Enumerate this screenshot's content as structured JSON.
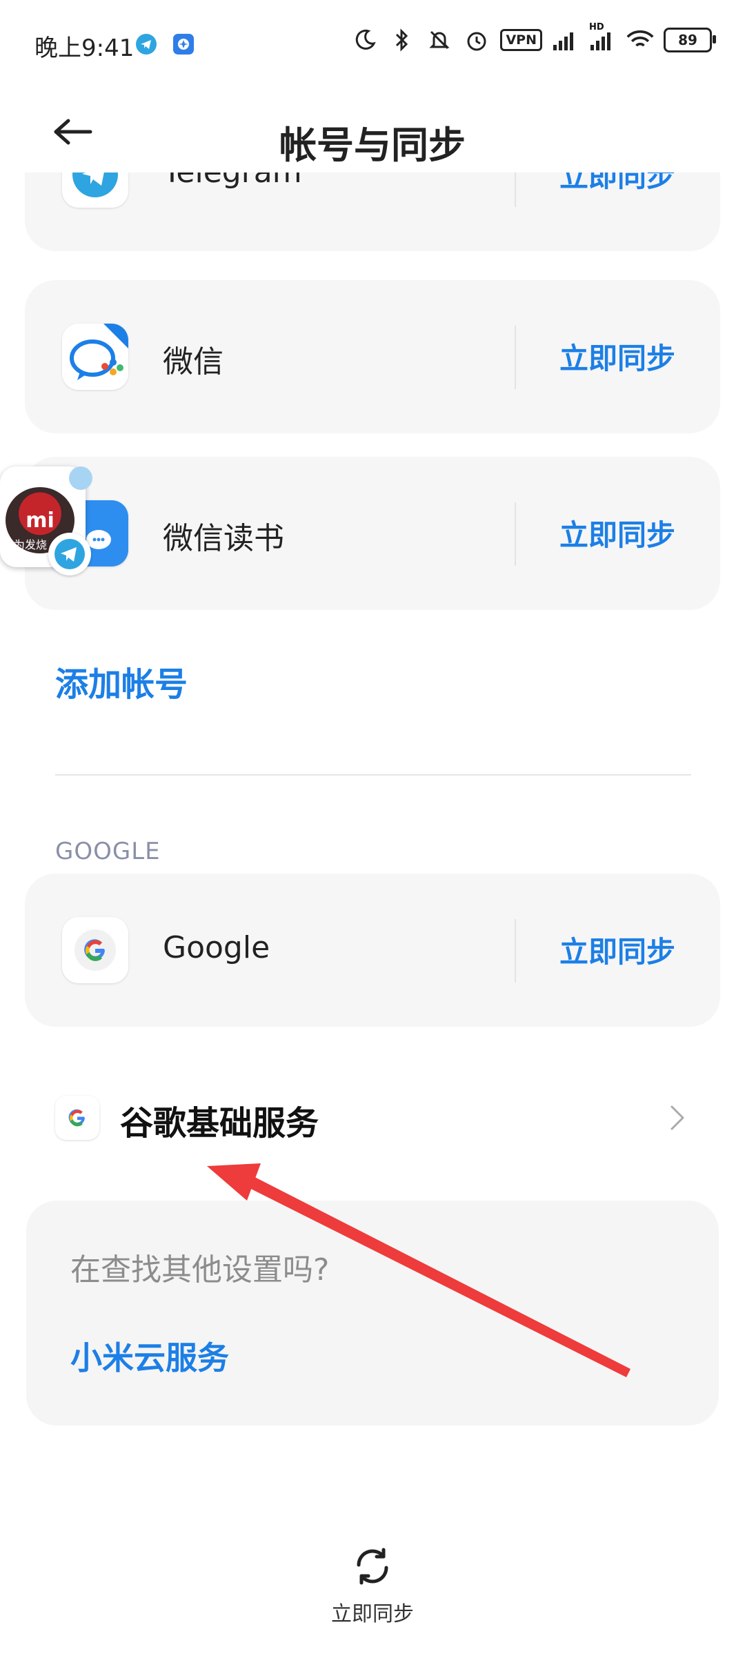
{
  "status_bar": {
    "time": "晚上9:41",
    "vpn": "VPN",
    "network_tag": "HD",
    "battery": "89",
    "icons": [
      "telegram-icon",
      "app-badge-icon",
      "moon-icon",
      "bluetooth-icon",
      "mute-icon",
      "alarm-icon",
      "vpn-icon",
      "signal-icon",
      "signal-hd-icon",
      "wifi-icon",
      "battery-icon"
    ]
  },
  "header": {
    "title": "帐号与同步",
    "back_icon": "arrow-left-icon"
  },
  "accounts": [
    {
      "name": "Telegram",
      "icon": "telegram-icon",
      "action": "立即同步"
    },
    {
      "name": "微信",
      "icon": "wechat-icon",
      "action": "立即同步"
    },
    {
      "name": "微信读书",
      "icon": "wechat-read-icon",
      "action": "立即同步"
    }
  ],
  "add_account": "添加帐号",
  "google_section": {
    "label": "GOOGLE",
    "account": {
      "name": "Google",
      "icon": "google-icon",
      "action": "立即同步"
    }
  },
  "gms": {
    "label": "谷歌基础服务",
    "icon": "google-icon"
  },
  "find_more": {
    "question": "在查找其他设置吗?",
    "link": "小米云服务"
  },
  "bottom": {
    "sync_label": "立即同步",
    "icon": "sync-icon"
  },
  "floating_bubble": {
    "logo_text": "mi",
    "caption": "为发烧"
  },
  "colors": {
    "accent": "#1c7fe6",
    "card_bg": "#f6f6f6",
    "annotation_arrow": "#ee3b3b"
  }
}
